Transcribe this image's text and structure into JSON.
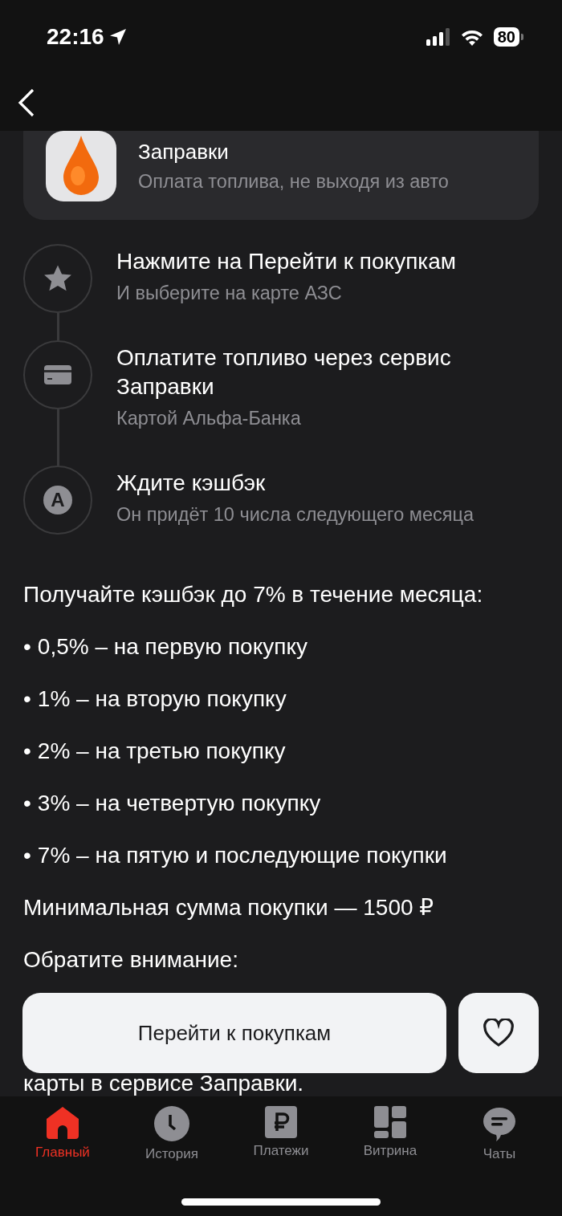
{
  "status_bar": {
    "time": "22:16",
    "battery": "80"
  },
  "service_card": {
    "title": "Заправки",
    "subtitle": "Оплата топлива, не выходя из авто"
  },
  "steps": [
    {
      "kind": "star",
      "title": "Нажмите на Перейти к покупкам",
      "subtitle": "И выберите на карте АЗС"
    },
    {
      "kind": "card",
      "title": "Оплатите топливо через сервис Заправки",
      "subtitle": "Картой Альфа-Банка"
    },
    {
      "kind": "letter",
      "icon_text": "A",
      "title": "Ждите кэшбэк",
      "subtitle": "Он придёт 10 числа следующего месяца"
    }
  ],
  "paragraphs": [
    {
      "kind": "text",
      "text": "Получайте кэшбэк до 7% в течение месяца:"
    },
    {
      "kind": "bullet",
      "bullet": "•",
      "text": "0,5% – на первую покупку"
    },
    {
      "kind": "bullet",
      "bullet": "•",
      "text": "1% – на вторую покупку"
    },
    {
      "kind": "bullet",
      "bullet": "•",
      "text": "2% – на третью покупку"
    },
    {
      "kind": "bullet",
      "bullet": "•",
      "text": "3% – на четвертую покупку"
    },
    {
      "kind": "bullet",
      "bullet": "•",
      "text": "7% – на пятую и последующие покупки"
    },
    {
      "kind": "text",
      "text": "Минимальная сумма покупки — 1500 ₽"
    },
    {
      "kind": "text",
      "text": "Обратите внимание:"
    }
  ],
  "partly_hidden_line": "карты в сервисе Заправки.",
  "primary_button": "Перейти к покупкам",
  "tabs": [
    {
      "kind": "home",
      "label": "Главный",
      "selected": true
    },
    {
      "kind": "history",
      "label": "История",
      "selected": false
    },
    {
      "kind": "payments",
      "label": "Платежи",
      "selected": false
    },
    {
      "kind": "showcase",
      "label": "Витрина",
      "selected": false
    },
    {
      "kind": "chats",
      "label": "Чаты",
      "selected": false
    }
  ]
}
